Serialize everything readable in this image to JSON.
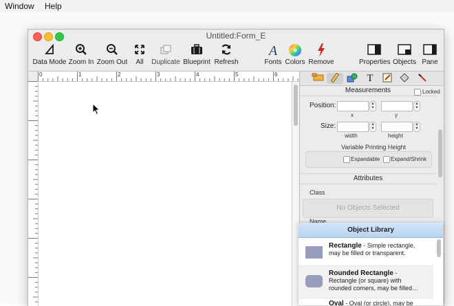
{
  "menubar": {
    "window": "Window",
    "help": "Help"
  },
  "window": {
    "title": "Untitled:Form_E"
  },
  "toolbar": {
    "data_mode": "Data Mode",
    "zoom_in": "Zoom In",
    "zoom_out": "Zoom Out",
    "all": "All",
    "duplicate": "Duplicate",
    "blueprint": "Blueprint",
    "refresh": "Refresh",
    "fonts": "Fonts",
    "colors": "Colors",
    "remove": "Remove",
    "properties": "Properties",
    "objects": "Objects",
    "pane": "Pane"
  },
  "ruler": {
    "top_marks": [
      "0",
      "1",
      "2",
      "3",
      "4",
      "5",
      "6"
    ]
  },
  "panel": {
    "measurements": "Measurements",
    "locked": "Locked",
    "position": "Position:",
    "x": "x",
    "y": "y",
    "size": "Size:",
    "width": "width",
    "height": "height",
    "vph": "Variable Printing Height",
    "expandable": "Expandable",
    "expand_shrink": "Expand/Shrink",
    "attributes": "Attributes",
    "class": "Class",
    "no_selection": "No Objects Selected",
    "name": "Name"
  },
  "library": {
    "title": "Object Library",
    "items": [
      {
        "name": "Rectangle",
        "desc1": " - Simple rectangle,",
        "desc2": "may be filled or transparent."
      },
      {
        "name": "Rounded Rectangle",
        "desc1": " -",
        "desc2": "Rectangle (or square) with",
        "desc3": "rounded corners, may be filled…"
      },
      {
        "name": "Oval",
        "desc1": " - Oval (or circle), may be"
      }
    ]
  }
}
